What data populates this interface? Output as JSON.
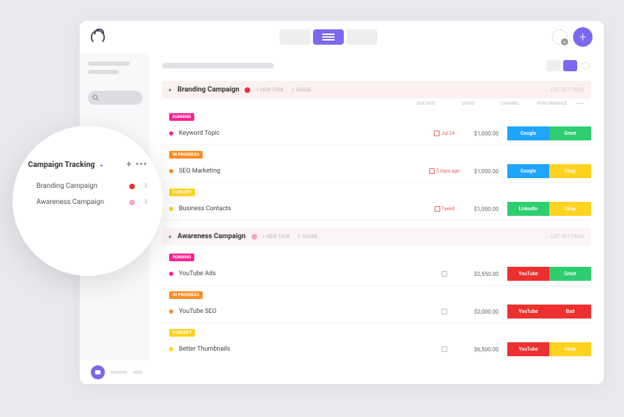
{
  "colors": {
    "purple": "#7b68ee",
    "red": "#ec2f2f",
    "pink": "#ff4da6",
    "orange": "#ff8b1f",
    "yellow": "#ffd21f",
    "green": "#2ecd6f",
    "blue": "#1fa4ff",
    "magenta": "#ff1f8f"
  },
  "popover": {
    "title": "Campaign Tracking",
    "items": [
      {
        "label": "Branding Campaign",
        "dot": "#ec2f2f",
        "count": "3"
      },
      {
        "label": "Awareness Campaign",
        "dot": "#ff9fc2",
        "count": "3"
      }
    ]
  },
  "columns": {
    "c1": "DUE DATE",
    "c2": "SPEND",
    "c3": "CHANNEL",
    "c4": "PERFORMANCE"
  },
  "group_actions": {
    "new": "+ NEW TASK",
    "share": "⇪ SHARE",
    "settings": "⋯ LIST SETTINGS"
  },
  "groups": [
    {
      "title": "Branding Campaign",
      "dot": "#ec2f2f",
      "tint": "red",
      "sections": [
        {
          "status": "RUNNING",
          "status_bg": "#ff1f8f",
          "rows": [
            {
              "dot": "#ff1f8f",
              "name": "Keyword Topic",
              "due": "Jul 24",
              "due_cls": "red",
              "spend": "$1,000.00",
              "ch": "Google",
              "ch_bg": "#1fa4ff",
              "perf": "Great",
              "perf_bg": "#2ecd6f"
            }
          ]
        },
        {
          "status": "IN PROGRESS",
          "status_bg": "#ff8b1f",
          "rows": [
            {
              "dot": "#ff8b1f",
              "name": "SEO Marketing",
              "due": "5 days ago",
              "due_cls": "red",
              "spend": "$1,000.00",
              "ch": "Google",
              "ch_bg": "#1fa4ff",
              "perf": "Okay",
              "perf_bg": "#ffd21f"
            }
          ]
        },
        {
          "status": "CONCEPT",
          "status_bg": "#ffd21f",
          "rows": [
            {
              "dot": "#ffd21f",
              "name": "Business Contacts",
              "due": "Tyeed",
              "due_cls": "red",
              "spend": "$1,000.00",
              "ch": "LinkedIn",
              "ch_bg": "#2ecd6f",
              "perf": "Okay",
              "perf_bg": "#ffd21f"
            }
          ]
        }
      ]
    },
    {
      "title": "Awareness Campaign",
      "dot": "#ff9fc2",
      "tint": "pink",
      "sections": [
        {
          "status": "RUNNING",
          "status_bg": "#ff1f8f",
          "rows": [
            {
              "dot": "#ff1f8f",
              "name": "YouTube Ads",
              "due": "",
              "due_cls": "gray",
              "spend": "$2,550.00",
              "ch": "YouTube",
              "ch_bg": "#ec2f2f",
              "perf": "Great",
              "perf_bg": "#2ecd6f"
            }
          ]
        },
        {
          "status": "IN PROGRESS",
          "status_bg": "#ff8b1f",
          "rows": [
            {
              "dot": "#ff8b1f",
              "name": "YouTube SEO",
              "due": "",
              "due_cls": "gray",
              "spend": "$2,000.00",
              "ch": "YouTube",
              "ch_bg": "#ec2f2f",
              "perf": "Bad",
              "perf_bg": "#ec2f2f"
            }
          ]
        },
        {
          "status": "CONCEPT",
          "status_bg": "#ffd21f",
          "rows": [
            {
              "dot": "#ffd21f",
              "name": "Better Thumbnails",
              "due": "",
              "due_cls": "gray",
              "spend": "$6,500.00",
              "ch": "YouTube",
              "ch_bg": "#ec2f2f",
              "perf": "Okay",
              "perf_bg": "#ffd21f"
            }
          ]
        }
      ]
    }
  ]
}
